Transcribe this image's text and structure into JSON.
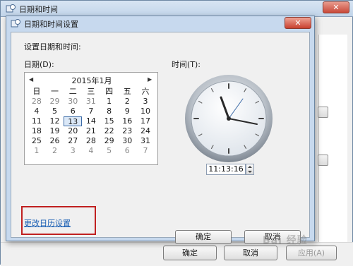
{
  "outer_window": {
    "title": "日期和时间",
    "close_label": "✕",
    "buttons": {
      "ok": "确定",
      "cancel": "取消",
      "apply": "应用(A)"
    }
  },
  "dialog": {
    "title": "日期和时间设置",
    "close_label": "✕",
    "heading": "设置日期和时间:",
    "date_label": "日期(D):",
    "time_label": "时间(T):",
    "calendar": {
      "month_label": "2015年1月",
      "prev_icon": "◀",
      "next_icon": "▶",
      "weekdays": [
        "日",
        "一",
        "二",
        "三",
        "四",
        "五",
        "六"
      ],
      "weeks": [
        [
          "28",
          "29",
          "30",
          "31",
          "1",
          "2",
          "3"
        ],
        [
          "4",
          "5",
          "6",
          "7",
          "8",
          "9",
          "10"
        ],
        [
          "11",
          "12",
          "13",
          "14",
          "15",
          "16",
          "17"
        ],
        [
          "18",
          "19",
          "20",
          "21",
          "22",
          "23",
          "24"
        ],
        [
          "25",
          "26",
          "27",
          "28",
          "29",
          "30",
          "31"
        ],
        [
          "1",
          "2",
          "3",
          "4",
          "5",
          "6",
          "7"
        ]
      ],
      "selected_day": "13"
    },
    "time_value": "11:13:16",
    "change_calendar_link": "更改日历设置",
    "ok_label": "确定",
    "cancel_label": "取消"
  },
  "watermark": "Bai 经验"
}
